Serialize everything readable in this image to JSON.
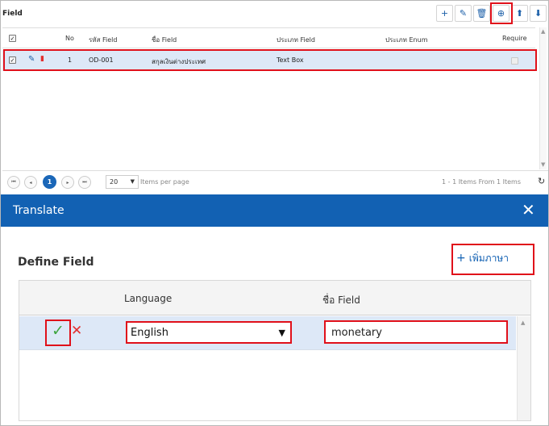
{
  "field_panel": {
    "title": "Field",
    "toolbar": [
      {
        "name": "add",
        "icon": "plus-icon",
        "glyph": "+"
      },
      {
        "name": "edit",
        "icon": "pencil-icon",
        "glyph": "✎"
      },
      {
        "name": "delete",
        "icon": "trash-icon",
        "glyph": "🗑"
      },
      {
        "name": "translate",
        "icon": "globe-icon",
        "glyph": "⊕"
      },
      {
        "name": "move-up",
        "icon": "arrow-up-icon",
        "glyph": "⬆"
      },
      {
        "name": "move-down",
        "icon": "arrow-down-icon",
        "glyph": "⬇"
      }
    ],
    "columns": {
      "no": "No",
      "code": "รหัส Field",
      "name": "ชื่อ Field",
      "type": "ประเภท Field",
      "enum_type": "ประเภท Enum",
      "require": "Require"
    },
    "rows": [
      {
        "no": "1",
        "code": "OD-001",
        "name": "สกุลเงินต่างประเทศ",
        "type": "Text Box",
        "enum_type": "",
        "checked": true
      }
    ],
    "pager": {
      "first": "⏮",
      "prev": "◂",
      "current": "1",
      "next": "▸",
      "last": "⏭",
      "page_size": "20",
      "items_per_page": "Items per page",
      "summary": "1 - 1 Items From 1 Items",
      "refresh": "↻"
    }
  },
  "translate_dialog": {
    "title": "Translate",
    "close": "✕",
    "section_title": "Define Field",
    "add_language": "เพิ่มภาษา",
    "add_plus": "+",
    "columns": {
      "language": "Language",
      "field_name": "ชื่อ Field"
    },
    "row": {
      "language": "English",
      "field_name": "monetary",
      "confirm": "✓",
      "cancel": "✕"
    }
  },
  "colors": {
    "accent": "#1261b3",
    "highlight": "#e0101a",
    "selected_row": "#dde8f7",
    "confirm": "#3fa53f",
    "cancel": "#e23030"
  }
}
